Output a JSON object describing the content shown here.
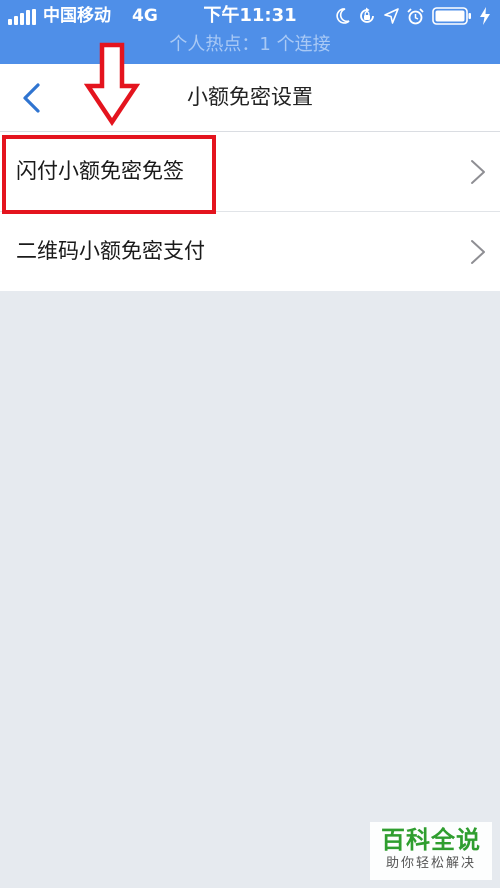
{
  "status_bar": {
    "carrier": "中国移动",
    "network": "4G",
    "time": "下午11:31",
    "hotspot_text": "个人热点：1 个连接",
    "background_color": "#4f8fe8",
    "icons": [
      "signal-icon",
      "moon-icon",
      "rotation-lock-icon",
      "location-icon",
      "alarm-icon",
      "battery-icon",
      "charging-icon"
    ]
  },
  "nav": {
    "title": "小额免密设置",
    "back_icon": "chevron-left-icon"
  },
  "list": {
    "items": [
      {
        "label": "闪付小额免密免签",
        "icon": "chevron-right-icon",
        "highlighted": true
      },
      {
        "label": "二维码小额免密支付",
        "icon": "chevron-right-icon",
        "highlighted": false
      }
    ]
  },
  "annotation": {
    "color": "#e4141e",
    "arrow_icon": "down-arrow-icon"
  },
  "watermark": {
    "title": "百科全说",
    "subtitle": "助你轻松解决"
  }
}
